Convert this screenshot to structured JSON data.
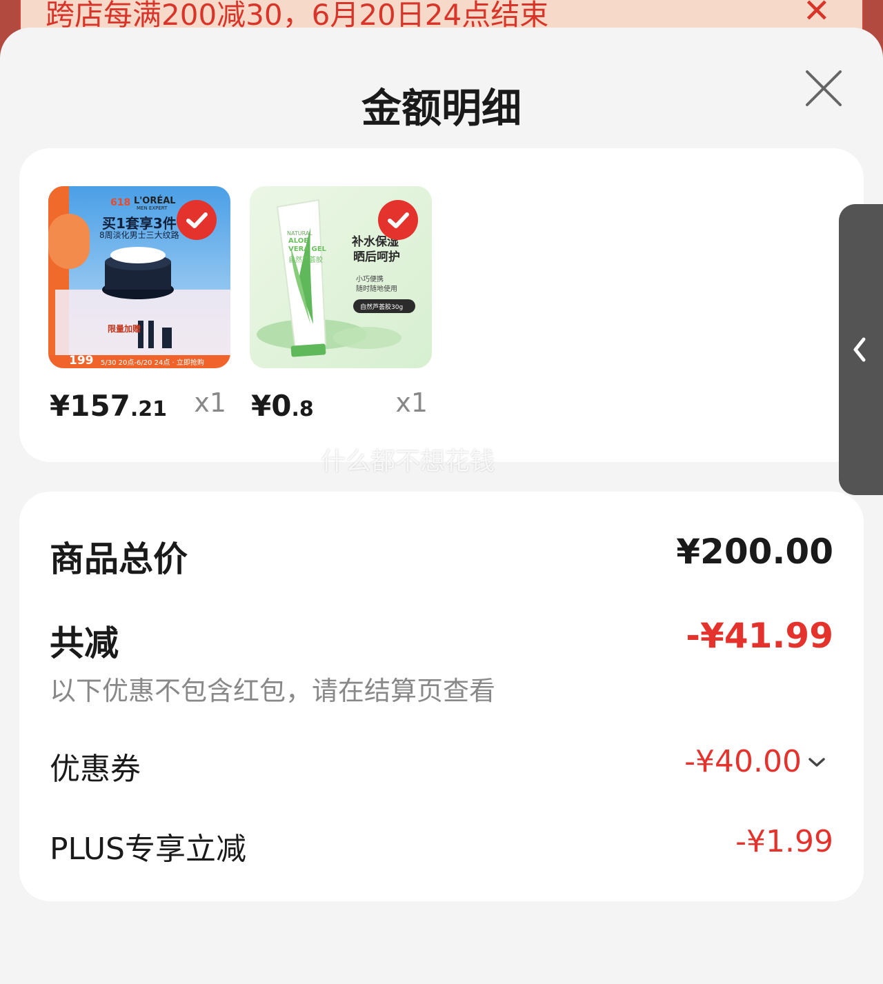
{
  "promo": {
    "text": "跨店每满200减30，6月20日24点结束",
    "close_icon": "close-icon"
  },
  "sheet": {
    "title": "金额明细",
    "close_icon": "close-icon"
  },
  "products": [
    {
      "price_symbol": "¥",
      "price_int": "157",
      "price_dec": ".21",
      "qty": "x1",
      "selected": true,
      "thumb": {
        "brand": "L'ORÉAL",
        "brand_sub": "MEN EXPERT",
        "tag": "618",
        "headline": "买1套享3件",
        "subline": "8周淡化男士三大纹路",
        "gift": "限量加赠",
        "promo_price": "199",
        "promo_time": "5/30 20点-6/20 24点 · 立即抢购"
      }
    },
    {
      "price_symbol": "¥",
      "price_int": "0",
      "price_dec": ".8",
      "qty": "x1",
      "selected": true,
      "thumb": {
        "tube_text_1": "NATURAL",
        "tube_text_2": "ALOE",
        "tube_text_3": "VERA GEL",
        "tube_text_4": "自然芦荟胶",
        "quote_1": "补水保湿",
        "quote_2": "晒后呵护",
        "small_1": "小巧便携",
        "small_2": "随时随地使用",
        "pill": "自然芦荟胶30g"
      }
    }
  ],
  "watermark": "什么都不想花钱",
  "summary": {
    "total_label": "商品总价",
    "total_value": "¥200.00",
    "discount_label": "共减",
    "discount_value": "-¥41.99",
    "discount_note": "以下优惠不包含红包，请在结算页查看",
    "coupon_label": "优惠券",
    "coupon_value": "-¥40.00",
    "plus_label": "PLUS专享立减",
    "plus_value": "-¥1.99"
  },
  "colors": {
    "accent_red": "#e4322c",
    "text_dark": "#1a1a1a",
    "text_gray": "#888888"
  }
}
